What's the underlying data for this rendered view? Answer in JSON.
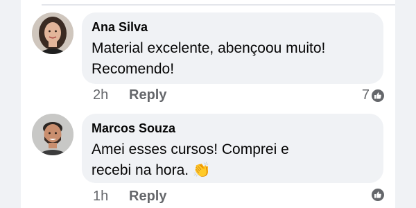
{
  "comments": [
    {
      "author": "Ana Silva",
      "text": "Material excelente, abençoou muito!\nRecomendo!",
      "time": "2h",
      "reply_label": "Reply",
      "like_count": "7"
    },
    {
      "author": "Marcos Souza",
      "text": "Amei esses cursos! Comprei e\nrecebi na hora. 👏",
      "time": "1h",
      "reply_label": "Reply",
      "like_count": ""
    }
  ],
  "icons": {
    "like": "thumbs-up-icon"
  },
  "colors": {
    "bubble": "#f0f2f5",
    "meta_text": "#65676b",
    "name_text": "#050505"
  }
}
